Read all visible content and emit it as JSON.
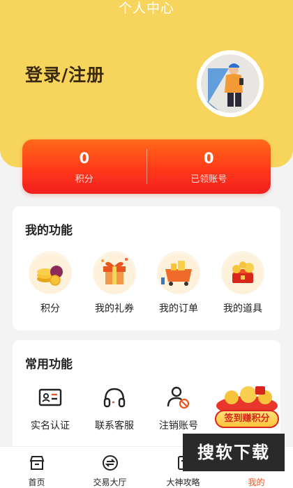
{
  "header": {
    "title": "个人中心",
    "login_label": "登录/注册"
  },
  "stats": [
    {
      "value": "0",
      "label": "积分"
    },
    {
      "value": "0",
      "label": "已领账号"
    }
  ],
  "my_functions": {
    "title": "我的功能",
    "items": [
      {
        "label": "积分",
        "icon": "coins-icon"
      },
      {
        "label": "我的礼券",
        "icon": "gift-box-icon"
      },
      {
        "label": "我的订单",
        "icon": "cart-icon"
      },
      {
        "label": "我的道具",
        "icon": "treasure-icon"
      }
    ]
  },
  "common_functions": {
    "title": "常用功能",
    "items": [
      {
        "label": "实名认证",
        "icon": "id-card-icon"
      },
      {
        "label": "联系客服",
        "icon": "headphones-icon"
      },
      {
        "label": "注销账号",
        "icon": "user-cancel-icon"
      }
    ]
  },
  "promo": {
    "label": "签到赚积分"
  },
  "watermark": "搜软下载",
  "bottom_nav": [
    {
      "label": "首页",
      "icon": "home-shop-icon",
      "active": false
    },
    {
      "label": "交易大厅",
      "icon": "exchange-icon",
      "active": false
    },
    {
      "label": "大神攻略",
      "icon": "guide-icon",
      "active": false
    },
    {
      "label": "我的",
      "icon": "user-icon",
      "active": true
    }
  ],
  "colors": {
    "header_bg": "#f7d45c",
    "stats_gradient_start": "#ff6a1a",
    "stats_gradient_end": "#f21e1e",
    "accent": "#e8551f"
  }
}
